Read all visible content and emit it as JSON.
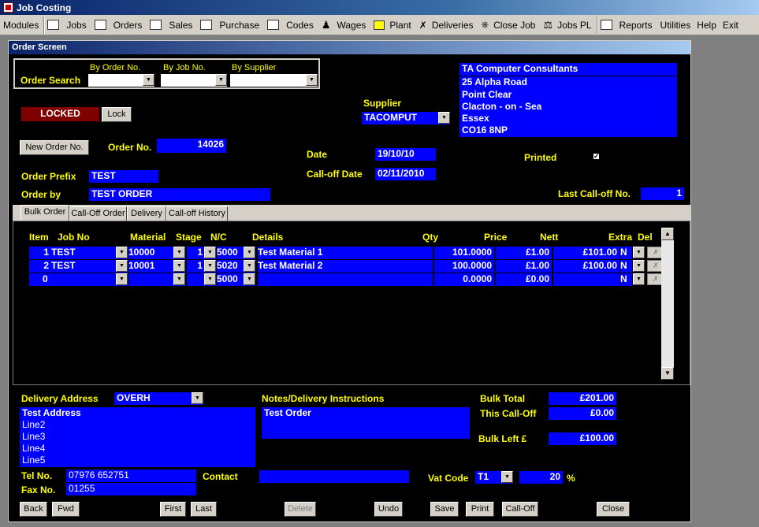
{
  "app": {
    "title": "Job Costing"
  },
  "toolbar": {
    "items": [
      {
        "label": "Modules",
        "icon": ""
      },
      {
        "label": "Jobs",
        "icon": "jobs-icon"
      },
      {
        "label": "Orders",
        "icon": "orders-icon"
      },
      {
        "label": "Sales",
        "icon": "sales-icon"
      },
      {
        "label": "Purchase",
        "icon": "purchase-icon"
      },
      {
        "label": "Codes",
        "icon": "codes-icon"
      },
      {
        "label": "Wages",
        "icon": "person-icon"
      },
      {
        "label": "Plant",
        "icon": "plant-icon"
      },
      {
        "label": "Deliveries",
        "icon": "wrench-icon"
      },
      {
        "label": "Close Job",
        "icon": "key-icon"
      },
      {
        "label": "Jobs PL",
        "icon": "scales-icon"
      },
      {
        "label": "Reports",
        "icon": "reports-icon"
      },
      {
        "label": "Utilities",
        "icon": ""
      },
      {
        "label": "Help",
        "icon": ""
      },
      {
        "label": "Exit",
        "icon": ""
      }
    ]
  },
  "window": {
    "title": "Order Screen"
  },
  "search": {
    "label": "Order Search",
    "by_order": "By Order No.",
    "by_job": "By Job No.",
    "by_supplier": "By Supplier"
  },
  "supplier": {
    "label": "Supplier",
    "code": "TACOMPUT",
    "address": [
      "TA Computer Consultants",
      "25 Alpha Road",
      "Point Clear",
      "Clacton - on - Sea",
      "Essex",
      "CO16 8NP"
    ]
  },
  "lock": {
    "status": "LOCKED",
    "button": "Lock"
  },
  "order": {
    "new_button": "New Order No.",
    "no_label": "Order No.",
    "no": "14026",
    "prefix_label": "Order Prefix",
    "prefix": "TEST",
    "by_label": "Order by",
    "by": "TEST ORDER",
    "date_label": "Date",
    "date": "19/10/10",
    "calloff_date_label": "Call-off Date",
    "calloff_date": "02/11/2010",
    "printed_label": "Printed",
    "printed_mark": "✓",
    "last_calloff_label": "Last Call-off No.",
    "last_calloff": "1"
  },
  "tabs": [
    "Bulk Order",
    "Call-Off Order",
    "Delivery",
    "Call-off History"
  ],
  "grid": {
    "headers": {
      "item": "Item",
      "job": "Job No",
      "material": "Material",
      "stage": "Stage",
      "nc": "N/C",
      "details": "Details",
      "qty": "Qty",
      "price": "Price",
      "nett": "Nett",
      "extra": "Extra",
      "del": "Del"
    },
    "rows": [
      {
        "item": "1",
        "job": "TEST",
        "material": "10000",
        "stage": "1",
        "nc": "5000",
        "details": "Test Material 1",
        "qty": "101.0000",
        "price": "£1.00",
        "nett": "£101.00",
        "extra": "N"
      },
      {
        "item": "2",
        "job": "TEST",
        "material": "10001",
        "stage": "1",
        "nc": "5020",
        "details": "Test Material 2",
        "qty": "100.0000",
        "price": "£1.00",
        "nett": "£100.00",
        "extra": "N"
      },
      {
        "item": "0",
        "job": "",
        "material": "",
        "stage": "",
        "nc": "5000",
        "details": "",
        "qty": "0.0000",
        "price": "£0.00",
        "nett": "",
        "extra": "N"
      }
    ]
  },
  "delivery": {
    "label": "Delivery Address",
    "code": "OVERH",
    "lines": [
      "Test Address",
      "Line2",
      "Line3",
      "Line4",
      "Line5"
    ]
  },
  "notes": {
    "label": "Notes/Delivery Instructions",
    "text": "Test Order"
  },
  "totals": {
    "bulk_label": "Bulk Total",
    "bulk": "£201.00",
    "calloff_label": "This Call-Off",
    "calloff": "£0.00",
    "left_label": "Bulk Left £",
    "left": "£100.00"
  },
  "contact": {
    "tel_label": "Tel No.",
    "tel": "07976 652751",
    "fax_label": "Fax No.",
    "fax": "01255",
    "contact_label": "Contact",
    "contact": ""
  },
  "vat": {
    "label": "Vat Code",
    "code": "T1",
    "rate": "20",
    "pct": "%"
  },
  "buttons": {
    "back": "Back",
    "fwd": "Fwd",
    "first": "First",
    "last": "Last",
    "delete": "Delete",
    "undo": "Undo",
    "save": "Save",
    "print": "Print",
    "calloff": "Call-Off",
    "close": "Close"
  }
}
